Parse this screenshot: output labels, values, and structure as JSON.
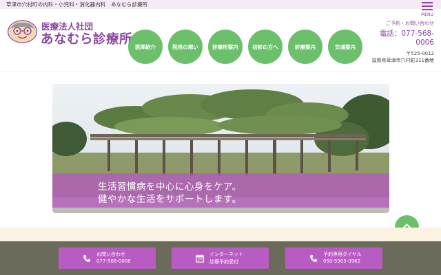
{
  "top_strip": {
    "text": "草津市穴村町の内科・小児科・消化器内科　あなむら診療所"
  },
  "header": {
    "org_name": "医療法人社団",
    "clinic_name": "あなむら診療所",
    "menu_label": "MENU"
  },
  "nav": [
    {
      "label": "医師紹介"
    },
    {
      "label": "院長の想い"
    },
    {
      "label": "診療所案内"
    },
    {
      "label": "初診の方へ"
    },
    {
      "label": "診療案内"
    },
    {
      "label": "交通案内"
    }
  ],
  "contact": {
    "caption": "ご予約・お問い合わせ",
    "phone_line1": "電話：077-568-",
    "phone_line2": "0006",
    "zip": "〒525-0012",
    "address": "滋賀県草津市穴村町311番地"
  },
  "hero": {
    "line1": "生活習慣病を中心に心身をケア。",
    "line2": "健やかな生活をサポートします。"
  },
  "footer_buttons": [
    {
      "icon": "phone-icon",
      "line1": "お問い合わせ",
      "line2": "077-568-0006"
    },
    {
      "icon": "calendar-icon",
      "line1": "インターネット",
      "line2": "診療予約受付"
    },
    {
      "icon": "phone-icon",
      "line1": "予約専用ダイヤル",
      "line2": "050-5305-0962"
    }
  ],
  "colors": {
    "brand_purple": "#8a46a0",
    "nav_green": "#6cc06c",
    "footer_button": "#b85cc4",
    "footer_bar": "#6b6b5c"
  }
}
